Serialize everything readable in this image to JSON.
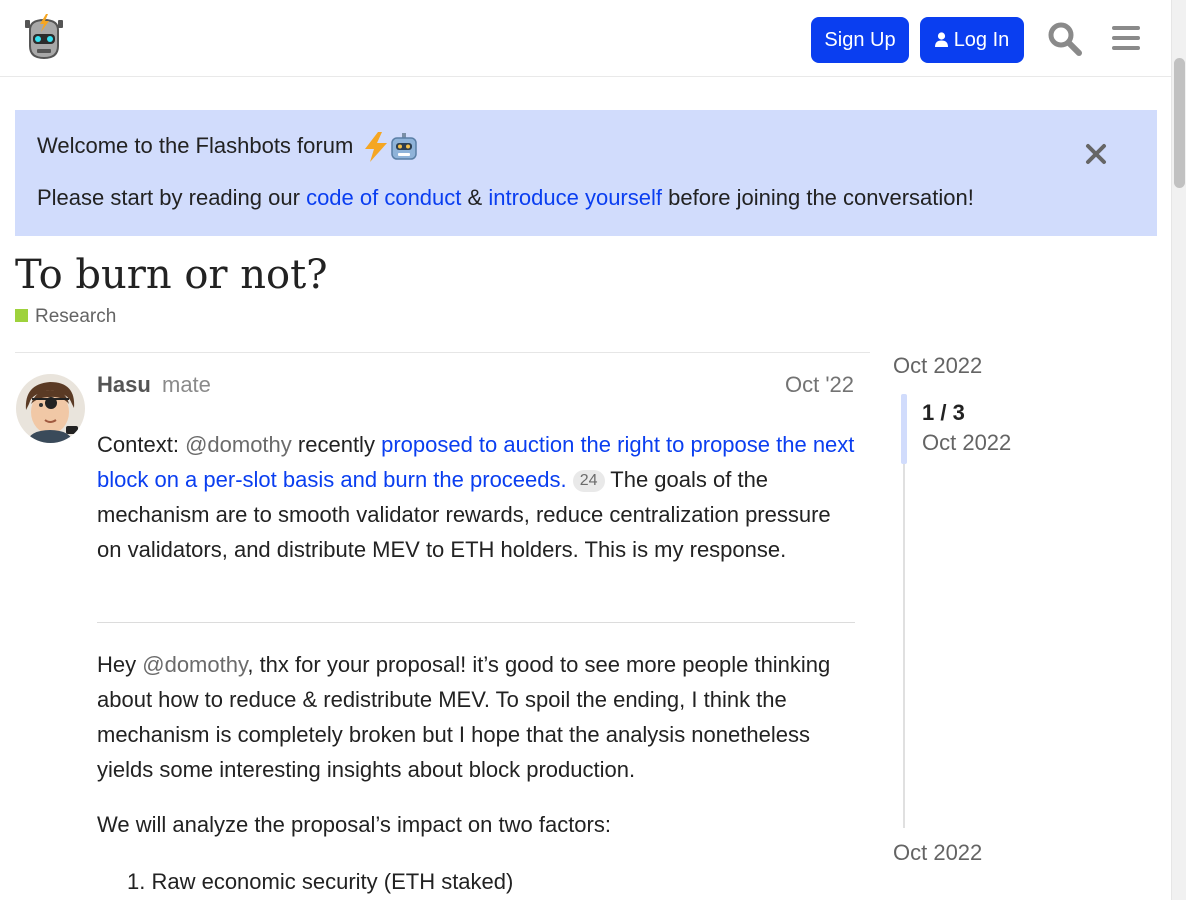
{
  "header": {
    "logo_icon": "flashbots-robot-logo-icon",
    "signup_label": "Sign Up",
    "login_label": "Log In",
    "search_icon": "search-icon",
    "menu_icon": "hamburger-menu-icon",
    "accent_color": "#0a3ef0"
  },
  "banner": {
    "line1": "Welcome to the Flashbots forum",
    "line1_emojis": [
      "lightning-bolt-icon",
      "robot-icon"
    ],
    "line2_prefix": "Please start by reading our",
    "code_of_conduct_link": "code of conduct",
    "ampersand": "&",
    "introduce_link": "introduce yourself",
    "line2_suffix": "before joining the conversation!",
    "background_color": "#d1dcfc"
  },
  "topic": {
    "title": "To burn or not?",
    "category": "Research",
    "category_color": "#9ed23c"
  },
  "post": {
    "username": "Hasu",
    "user_title": "mate",
    "date": "Oct '22",
    "context_label": "Context:",
    "mention1": "@domothy",
    "recently": "recently",
    "proposal_link": "proposed to auction the right to propose the next block on a per-slot basis and burn the proceeds.",
    "link_count": "24",
    "context_rest": "The goals of the mechanism are to smooth validator rewards, reduce centralization pressure on validators, and distribute MEV to ETH holders. This is my response.",
    "p2_hey": "Hey",
    "p2_mention": "@domothy",
    "p2_rest": ", thx for your proposal! it’s good to see more people thinking about how to reduce & redistribute MEV. To spoil the ending, I think the mechanism is completely broken but I hope that the analysis nonetheless yields some interesting insights about block production.",
    "p3": "We will analyze the proposal’s impact on two factors:",
    "list_item_1": "1. Raw economic security (ETH staked)"
  },
  "timeline": {
    "start_date": "Oct 2022",
    "position": "1 / 3",
    "position_date": "Oct 2022",
    "end_date": "Oct 2022"
  }
}
